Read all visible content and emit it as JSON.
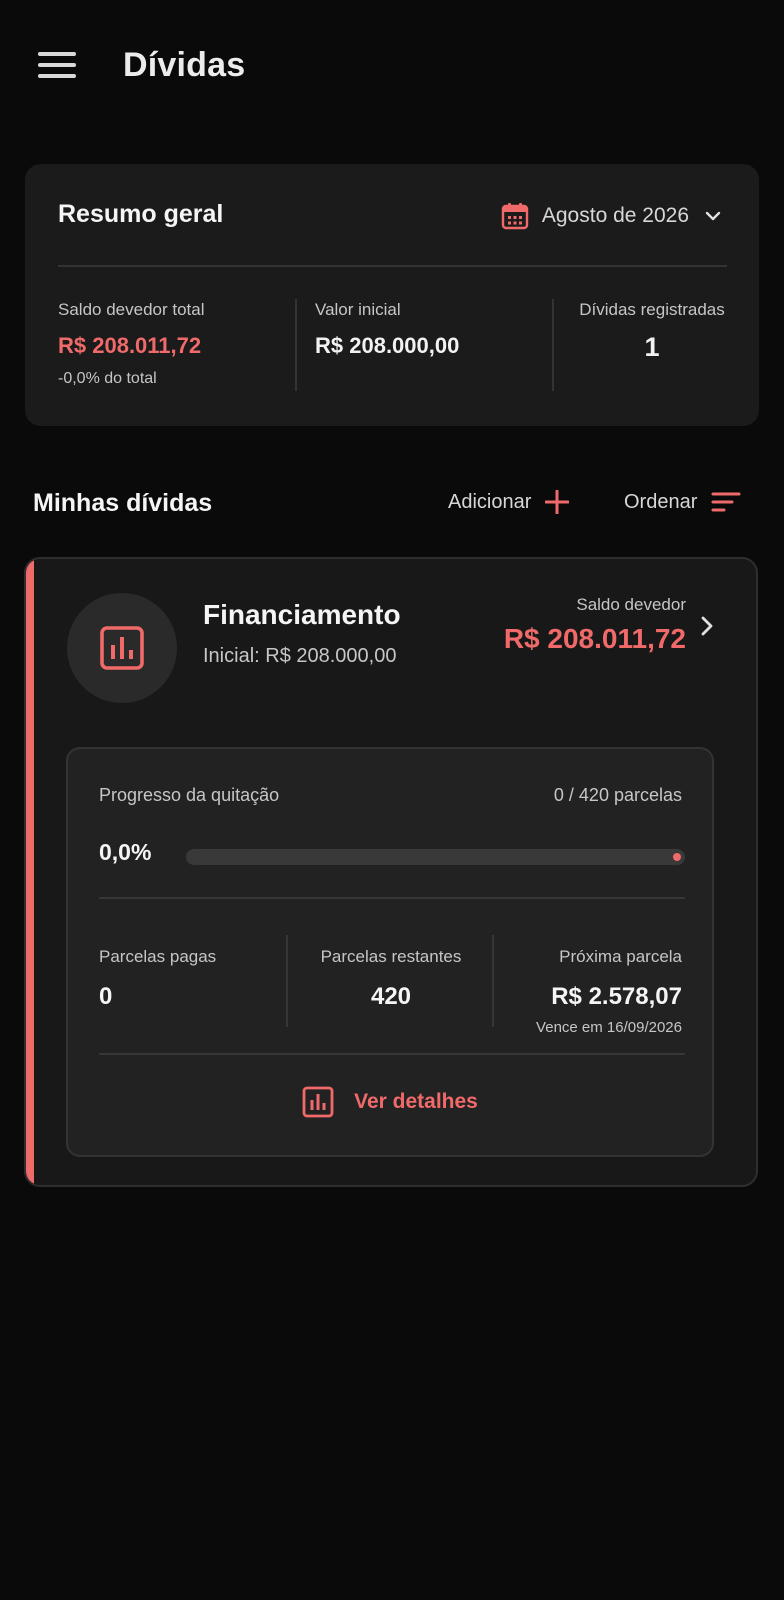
{
  "header": {
    "title": "Dívidas",
    "menu_icon": "menu-icon"
  },
  "colors": {
    "background": "#0a0a0a",
    "card": "#1b1b1b",
    "accent": "#f06a6a",
    "text": "#f5f5f5",
    "muted": "#c6c6c6"
  },
  "summary": {
    "title": "Resumo geral",
    "month": "Agosto de 2026",
    "total_balance_label": "Saldo devedor total",
    "total_balance_value": "R$ 208.011,72",
    "total_balance_sub": "-0,0% do total",
    "initial_value_label": "Valor inicial",
    "initial_value_value": "R$ 208.000,00",
    "registered_label": "Dívidas registradas",
    "registered_value": "1"
  },
  "section": {
    "title": "Minhas dívidas",
    "add_label": "Adicionar",
    "sort_label": "Ordenar"
  },
  "debts": [
    {
      "name": "Financiamento",
      "initial": "Inicial: R$ 208.000,00",
      "balance_label": "Saldo devedor",
      "balance_value": "R$ 208.011,72",
      "icon": "bar-chart-icon",
      "progress": {
        "label": "Progresso da quitação",
        "count": "0 / 420 parcelas",
        "percent_label": "0,0%",
        "fraction": 0.0
      },
      "paid_label": "Parcelas pagas",
      "paid_value": "0",
      "remaining_label": "Parcelas restantes",
      "remaining_value": "420",
      "next_label": "Próxima parcela",
      "next_value": "R$ 2.578,07",
      "next_due": "Vence em 16/09/2026",
      "details_label": "Ver detalhes"
    }
  ]
}
